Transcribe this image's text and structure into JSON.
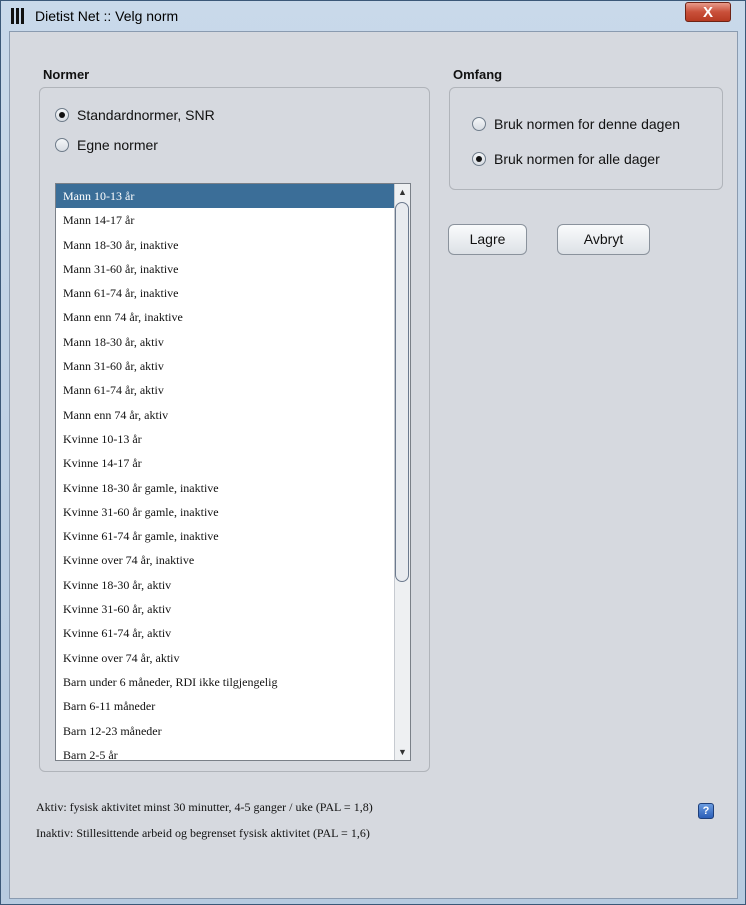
{
  "window": {
    "title": "Dietist Net :: Velg norm",
    "close_label": "X"
  },
  "normer": {
    "title": "Normer",
    "options": [
      {
        "label": "Standardnormer, SNR",
        "selected": true
      },
      {
        "label": "Egne normer",
        "selected": false
      }
    ],
    "list": [
      "Mann 10-13 år",
      "Mann 14-17 år",
      "Mann 18-30 år, inaktive",
      "Mann 31-60 år, inaktive",
      "Mann 61-74 år, inaktive",
      "Mann enn 74 år, inaktive",
      "Mann 18-30 år, aktiv",
      "Mann 31-60 år, aktiv",
      "Mann 61-74 år, aktiv",
      "Mann enn 74 år, aktiv",
      "Kvinne 10-13 år",
      "Kvinne 14-17 år",
      "Kvinne 18-30 år gamle, inaktive",
      "Kvinne 31-60 år gamle, inaktive",
      "Kvinne 61-74 år gamle, inaktive",
      "Kvinne over 74 år, inaktive",
      "Kvinne 18-30 år, aktiv",
      "Kvinne 31-60 år, aktiv",
      "Kvinne 61-74 år, aktiv",
      "Kvinne over 74 år, aktiv",
      "Barn under 6 måneder, RDI ikke tilgjengelig",
      "Barn 6-11 måneder",
      "Barn 12-23 måneder",
      "Barn 2-5 år"
    ],
    "selected_index": 0
  },
  "omfang": {
    "title": "Omfang",
    "options": [
      {
        "label": "Bruk normen for denne dagen",
        "selected": false
      },
      {
        "label": "Bruk normen for alle dager",
        "selected": true
      }
    ]
  },
  "buttons": {
    "save": "Lagre",
    "cancel": "Avbryt"
  },
  "notes": {
    "aktiv": "Aktiv: fysisk aktivitet minst 30 minutter, 4-5 ganger / uke (PAL = 1,8)",
    "inaktiv": "Inaktiv: Stillesittende arbeid og begrenset fysisk aktivitet (PAL = 1,6)"
  },
  "help_label": "?",
  "colors": {
    "selection": "#3b6e98",
    "close": "#c9503a"
  }
}
